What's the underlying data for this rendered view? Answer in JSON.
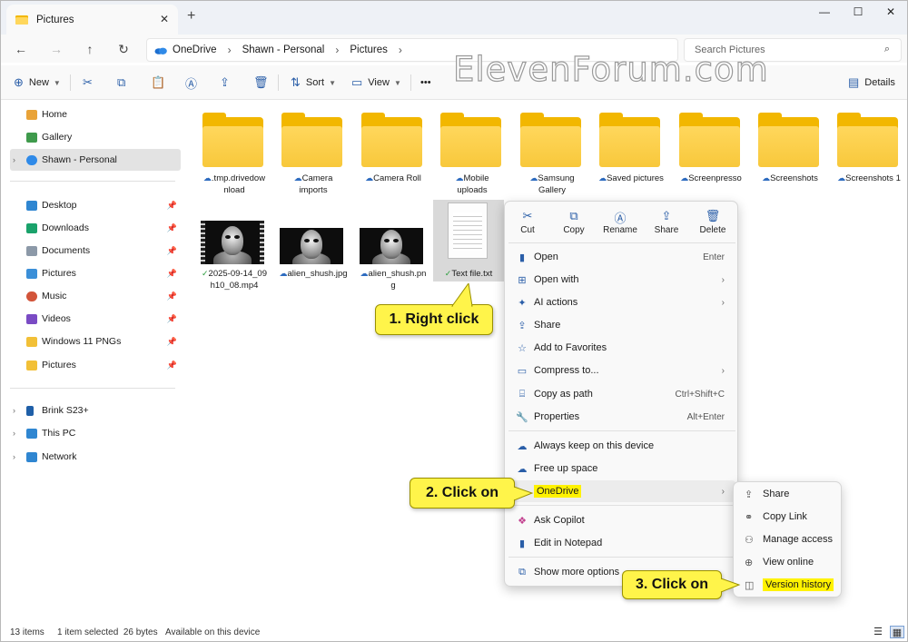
{
  "window": {
    "tab_title": "Pictures",
    "tab_close": "✕",
    "tab_new": "+",
    "minimize": "—",
    "maximize": "☐",
    "close": "✕"
  },
  "nav": {
    "back": "←",
    "forward": "→",
    "up": "↑",
    "refresh": "↻"
  },
  "address": {
    "crumbs": [
      "OneDrive",
      "Shawn - Personal",
      "Pictures"
    ],
    "sep": "›",
    "search_placeholder": "Search Pictures",
    "search_icon": "⌕"
  },
  "toolbar": {
    "new_label": "New",
    "sort_label": "Sort",
    "view_label": "View",
    "more": "•••",
    "details_label": "Details",
    "icons": {
      "new": "⊕",
      "cut": "✂",
      "copy": "⧉",
      "paste": "📋",
      "rename": "Ⓐ",
      "share": "⇪",
      "delete": "🗑",
      "sort": "⇅",
      "view": "▭",
      "details": "▤"
    }
  },
  "watermark": "ElevenForum.com",
  "sidebar": {
    "items": [
      {
        "label": "Home"
      },
      {
        "label": "Gallery"
      },
      {
        "label": "Shawn - Personal"
      },
      {
        "label": "Desktop"
      },
      {
        "label": "Downloads"
      },
      {
        "label": "Documents"
      },
      {
        "label": "Pictures"
      },
      {
        "label": "Music"
      },
      {
        "label": "Videos"
      },
      {
        "label": "Windows 11 PNGs"
      },
      {
        "label": "Pictures"
      },
      {
        "label": "Brink S23+"
      },
      {
        "label": "This PC"
      },
      {
        "label": "Network"
      }
    ],
    "expand": "›",
    "pin": "📌"
  },
  "files": {
    "folders": [
      {
        "line1": ".tmp.drivedow",
        "line2": "nload",
        "status": "☁"
      },
      {
        "line1": "Camera",
        "line2": "imports",
        "status": "☁"
      },
      {
        "line1": "Camera Roll",
        "line2": "",
        "status": "☁"
      },
      {
        "line1": "Mobile",
        "line2": "uploads",
        "status": "☁"
      },
      {
        "line1": "Samsung",
        "line2": "Gallery",
        "status": "☁"
      },
      {
        "line1": "Saved pictures",
        "line2": "",
        "status": "☁"
      },
      {
        "line1": "Screenpresso",
        "line2": "",
        "status": "☁"
      },
      {
        "line1": "Screenshots",
        "line2": "",
        "status": "☁"
      },
      {
        "line1": "Screenshots 1",
        "line2": "",
        "status": "☁"
      }
    ],
    "items": [
      {
        "line1": "2025-09-14_09",
        "line2": "h10_08.mp4",
        "status": "✓"
      },
      {
        "line1": "alien_shush.jpg",
        "line2": "",
        "status": "☁"
      },
      {
        "line1": "alien_shush.pn",
        "line2": "g",
        "status": "☁"
      },
      {
        "line1": "Text file.txt",
        "line2": "",
        "status": "✓"
      }
    ]
  },
  "context_menu": {
    "quick": [
      {
        "label": "Cut",
        "icon": "✂"
      },
      {
        "label": "Copy",
        "icon": "⧉"
      },
      {
        "label": "Rename",
        "icon": "Ⓐ"
      },
      {
        "label": "Share",
        "icon": "⇪"
      },
      {
        "label": "Delete",
        "icon": "🗑"
      }
    ],
    "items": [
      {
        "label": "Open",
        "shortcut": "Enter",
        "icon": "▮"
      },
      {
        "label": "Open with",
        "shortcut": "",
        "icon": "⊞"
      },
      {
        "label": "AI actions",
        "shortcut": "",
        "icon": "✦"
      },
      {
        "label": "Share",
        "shortcut": "",
        "icon": "⇪"
      },
      {
        "label": "Add to Favorites",
        "shortcut": "",
        "icon": "☆"
      },
      {
        "label": "Compress to...",
        "shortcut": "",
        "icon": "▭"
      },
      {
        "label": "Copy as path",
        "shortcut": "Ctrl+Shift+C",
        "icon": "⌸"
      },
      {
        "label": "Properties",
        "shortcut": "Alt+Enter",
        "icon": "🔧"
      },
      {
        "label": "Always keep on this device",
        "shortcut": "",
        "icon": "☁"
      },
      {
        "label": "Free up space",
        "shortcut": "",
        "icon": "☁"
      },
      {
        "label": "OneDrive",
        "shortcut": "",
        "icon": "☁"
      },
      {
        "label": "Ask Copilot",
        "shortcut": "",
        "icon": "❖"
      },
      {
        "label": "Edit in Notepad",
        "shortcut": "",
        "icon": "▮"
      },
      {
        "label": "Show more options",
        "shortcut": "",
        "icon": "⧉"
      }
    ],
    "submenu_arrow": "›"
  },
  "onedrive_submenu": {
    "items": [
      {
        "label": "Share",
        "icon": "⇪"
      },
      {
        "label": "Copy Link",
        "icon": "⚭"
      },
      {
        "label": "Manage access",
        "icon": "⚇"
      },
      {
        "label": "View online",
        "icon": "⊕"
      },
      {
        "label": "Version history",
        "icon": "◫"
      }
    ]
  },
  "callouts": [
    "1. Right click",
    "2. Click on",
    "3. Click on"
  ],
  "status_bar": {
    "count": "13 items",
    "selected": "1 item selected  26 bytes",
    "availability": "Available on this device"
  },
  "colors": {
    "accent": "#2a5ea8",
    "folder": "#f8c83b",
    "callout": "#fff44a",
    "highlight": "#fff200"
  }
}
